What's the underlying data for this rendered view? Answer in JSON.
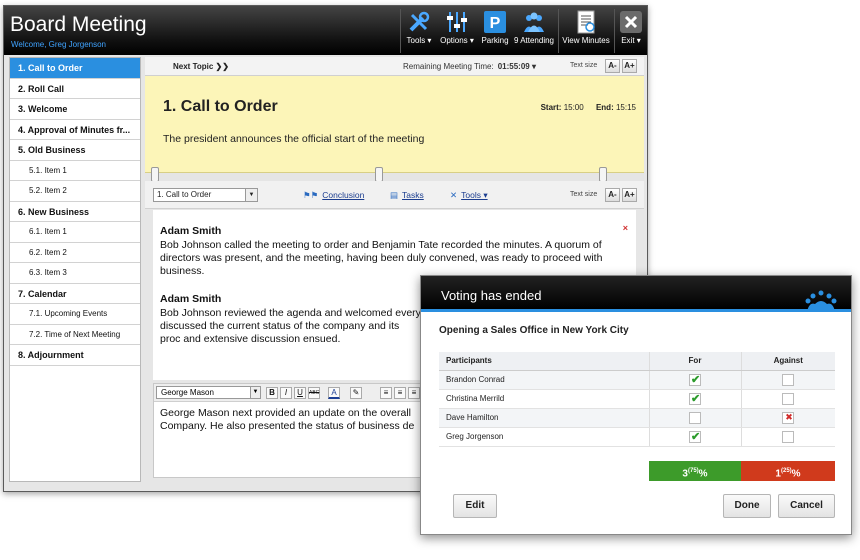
{
  "app": {
    "title": "Board Meeting",
    "welcome": "Welcome, Greg Jorgenson"
  },
  "toolbar": {
    "tools": "Tools ▾",
    "options": "Options ▾",
    "parking": "Parking",
    "attending": "9 Attending",
    "view_minutes": "View Minutes",
    "exit": "Exit ▾"
  },
  "sidebar": {
    "items": [
      {
        "label": "1. Call to Order"
      },
      {
        "label": "2. Roll Call"
      },
      {
        "label": "3. Welcome"
      },
      {
        "label": "4. Approval of Minutes fr..."
      },
      {
        "label": "5. Old Business"
      },
      {
        "label": "5.1. Item 1"
      },
      {
        "label": "5.2. Item 2"
      },
      {
        "label": "6. New Business"
      },
      {
        "label": "6.1. Item 1"
      },
      {
        "label": "6.2. Item 2"
      },
      {
        "label": "6.3. Item 3"
      },
      {
        "label": "7. Calendar"
      },
      {
        "label": "7.1. Upcoming Events"
      },
      {
        "label": "7.2. Time of Next Meeting"
      },
      {
        "label": "8. Adjournment"
      }
    ]
  },
  "topnav": {
    "next_topic": "Next Topic  ❯❯",
    "remaining_label": "Remaining Meeting Time:",
    "remaining_value": "01:55:09  ▾",
    "text_size": "Text size",
    "size_down": "A-",
    "size_up": "A+"
  },
  "topic": {
    "title": "1. Call to Order",
    "start_label": "Start:",
    "start_value": "15:00",
    "end_label": "End:",
    "end_value": "15:15",
    "description": "The president announces the official start of the meeting"
  },
  "toolbar2": {
    "topic_select": "1. Call to Order",
    "conclusion": "Conclusion",
    "tasks": "Tasks",
    "tools": "Tools ▾",
    "text_size": "Text size",
    "size_down": "A-",
    "size_up": "A+"
  },
  "minutes": {
    "entries": [
      {
        "speaker": "Adam Smith",
        "text": "Bob Johnson called the meeting to order and Benjamin Tate recorded the minutes. A quorum of directors was present, and the meeting, having been duly convened, was ready to proceed with business."
      },
      {
        "speaker": "Adam Smith",
        "text": "Bob Johnson reviewed the agenda and welcomed every discussed the current status of the company and its proc and extensive discussion ensued."
      }
    ],
    "delete_mark": "×"
  },
  "editor": {
    "speaker": "George Mason",
    "text_line1": "George Mason next provided an update on the overall s",
    "text_line2": "Company. He also presented the status of business dev",
    "fmt_bold": "B",
    "fmt_italic": "I",
    "fmt_underline": "U",
    "fmt_strike": "ABC",
    "fmt_color": "A",
    "fmt_highlight": "✎"
  },
  "dialog": {
    "title": "Voting has ended",
    "question": "Opening a Sales Office in New York City",
    "col_participants": "Participants",
    "col_for": "For",
    "col_against": "Against",
    "rows": [
      {
        "name": "Brandon Conrad",
        "vote": "for"
      },
      {
        "name": "Christina Merrild",
        "vote": "for"
      },
      {
        "name": "Dave Hamilton",
        "vote": "against"
      },
      {
        "name": "Greg Jorgenson",
        "vote": "for"
      }
    ],
    "for_count": "3",
    "for_pct": "(75)",
    "for_suffix": "%",
    "against_count": "1",
    "against_pct": "(25)",
    "against_suffix": "%",
    "edit": "Edit",
    "done": "Done",
    "cancel": "Cancel"
  },
  "colors": {
    "accent": "#2a8fe0",
    "for_bar": "#3d9b2a",
    "against_bar": "#d03a1c",
    "topic_bg": "#fcf5b8"
  }
}
